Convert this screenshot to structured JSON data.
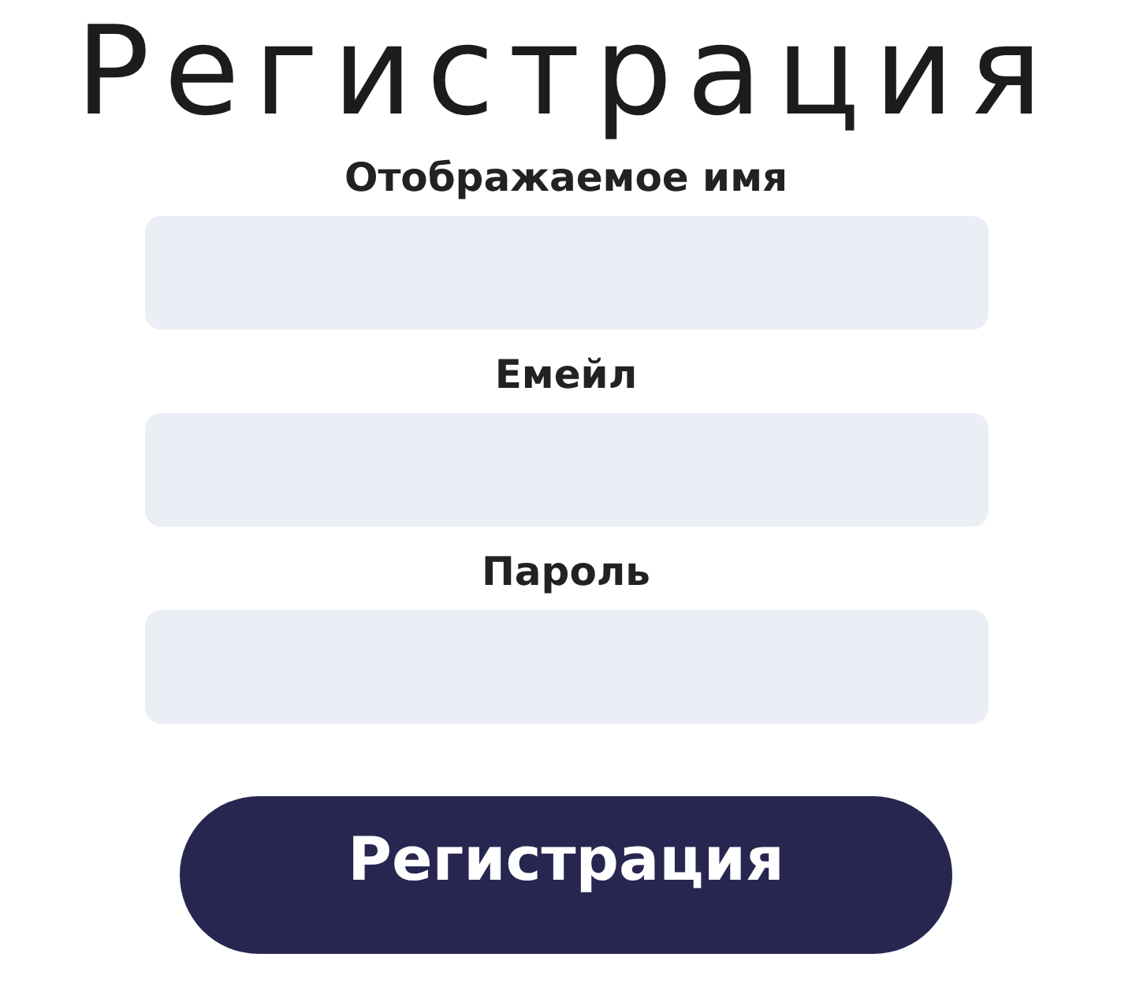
{
  "title": "Регистрация",
  "fields": [
    {
      "label": "Отображаемое имя"
    },
    {
      "label": "Емейл"
    },
    {
      "label": "Пароль"
    }
  ],
  "submit_button": "Регистрация"
}
